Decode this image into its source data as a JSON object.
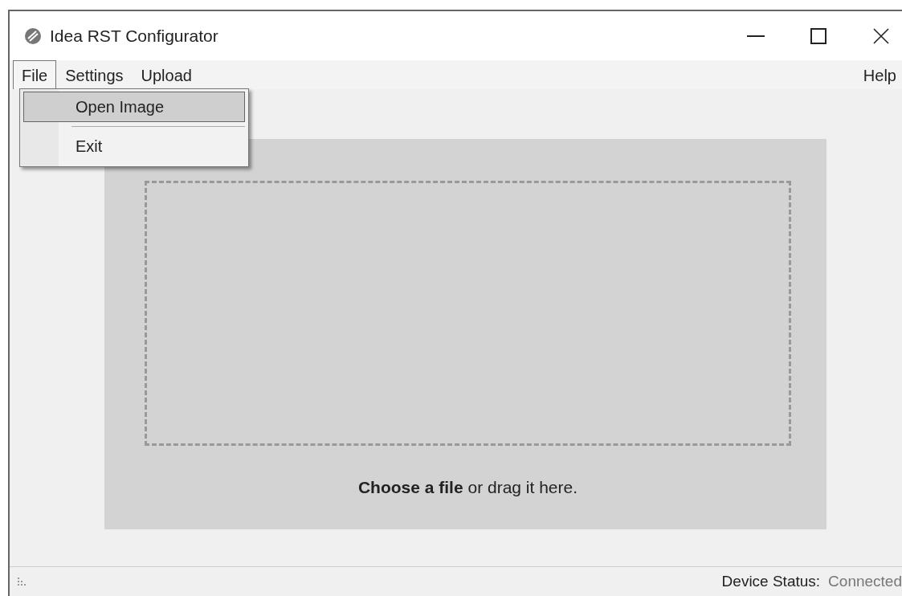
{
  "window": {
    "title": "Idea RST Configurator"
  },
  "menu_bar": {
    "items": [
      {
        "label": "File",
        "selected": true
      },
      {
        "label": "Settings",
        "selected": false
      },
      {
        "label": "Upload",
        "selected": false
      }
    ],
    "help": "Help"
  },
  "dropdown": {
    "items": [
      {
        "kind": "item",
        "label": "Open Image",
        "selected": true
      },
      {
        "kind": "separator"
      },
      {
        "kind": "item",
        "label": "Exit",
        "selected": false
      }
    ]
  },
  "drop_zone": {
    "text": "**Choose a file** or drag it here."
  },
  "status_bar": {
    "label": "Device Status:",
    "value": "Connected"
  }
}
